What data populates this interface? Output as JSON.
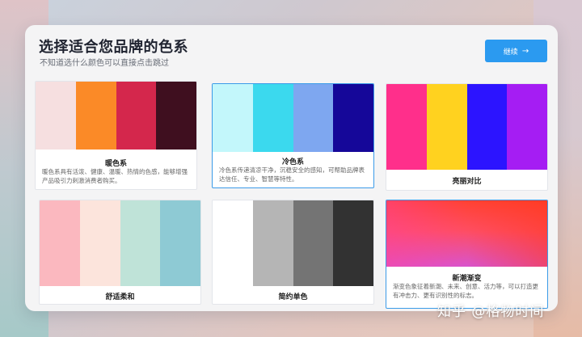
{
  "header": {
    "title": "选择适合您品牌的色系",
    "subtitle": "不知道选什么颜色可以直接点击跳过",
    "continue_label": "继续"
  },
  "cards": [
    {
      "name": "暖色系",
      "desc": "暖色系具有活泼、健康、温暖、热情的色感，能够增强产品吸引力刺激消费者购买。",
      "colors": [
        "#f6dfe0",
        "#fb8a27",
        "#d4274c",
        "#3f0f1f"
      ],
      "selected": false
    },
    {
      "name": "冷色系",
      "desc": "冷色系传递清凉干净，沉稳安全的感知，可帮助品牌表达信任、专业、智慧等特性。",
      "colors": [
        "#c3f7fb",
        "#3bd9ee",
        "#7ea7f0",
        "#150799"
      ],
      "selected": true
    },
    {
      "name": "亮丽对比",
      "desc": "",
      "colors": [
        "#ff2f8b",
        "#ffd21f",
        "#2c14ff",
        "#a51df3"
      ],
      "selected": false
    },
    {
      "name": "舒适柔和",
      "desc": "",
      "colors": [
        "#fbb8bf",
        "#fce4dc",
        "#bfe3d8",
        "#8ecad4"
      ],
      "selected": false
    },
    {
      "name": "简约单色",
      "desc": "",
      "colors": [
        "#ffffff",
        "#b5b5b5",
        "#747474",
        "#323232"
      ],
      "selected": false
    },
    {
      "name": "新潮渐变",
      "desc": "渐变色象征着新潮、未来、创意、活力等，可以打造更有冲击力、更有识别性的标志。",
      "colors": [],
      "selected": true
    }
  ],
  "watermark": "知乎 @格物时间",
  "accent_color": "#2b9af0"
}
